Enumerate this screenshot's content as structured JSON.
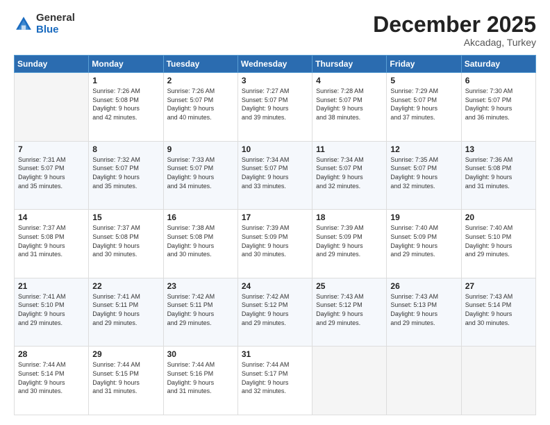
{
  "header": {
    "logo_general": "General",
    "logo_blue": "Blue",
    "month_title": "December 2025",
    "location": "Akcadag, Turkey"
  },
  "weekdays": [
    "Sunday",
    "Monday",
    "Tuesday",
    "Wednesday",
    "Thursday",
    "Friday",
    "Saturday"
  ],
  "weeks": [
    [
      {
        "day": "",
        "info": ""
      },
      {
        "day": "1",
        "info": "Sunrise: 7:26 AM\nSunset: 5:08 PM\nDaylight: 9 hours\nand 42 minutes."
      },
      {
        "day": "2",
        "info": "Sunrise: 7:26 AM\nSunset: 5:07 PM\nDaylight: 9 hours\nand 40 minutes."
      },
      {
        "day": "3",
        "info": "Sunrise: 7:27 AM\nSunset: 5:07 PM\nDaylight: 9 hours\nand 39 minutes."
      },
      {
        "day": "4",
        "info": "Sunrise: 7:28 AM\nSunset: 5:07 PM\nDaylight: 9 hours\nand 38 minutes."
      },
      {
        "day": "5",
        "info": "Sunrise: 7:29 AM\nSunset: 5:07 PM\nDaylight: 9 hours\nand 37 minutes."
      },
      {
        "day": "6",
        "info": "Sunrise: 7:30 AM\nSunset: 5:07 PM\nDaylight: 9 hours\nand 36 minutes."
      }
    ],
    [
      {
        "day": "7",
        "info": "Sunrise: 7:31 AM\nSunset: 5:07 PM\nDaylight: 9 hours\nand 35 minutes."
      },
      {
        "day": "8",
        "info": "Sunrise: 7:32 AM\nSunset: 5:07 PM\nDaylight: 9 hours\nand 35 minutes."
      },
      {
        "day": "9",
        "info": "Sunrise: 7:33 AM\nSunset: 5:07 PM\nDaylight: 9 hours\nand 34 minutes."
      },
      {
        "day": "10",
        "info": "Sunrise: 7:34 AM\nSunset: 5:07 PM\nDaylight: 9 hours\nand 33 minutes."
      },
      {
        "day": "11",
        "info": "Sunrise: 7:34 AM\nSunset: 5:07 PM\nDaylight: 9 hours\nand 32 minutes."
      },
      {
        "day": "12",
        "info": "Sunrise: 7:35 AM\nSunset: 5:07 PM\nDaylight: 9 hours\nand 32 minutes."
      },
      {
        "day": "13",
        "info": "Sunrise: 7:36 AM\nSunset: 5:08 PM\nDaylight: 9 hours\nand 31 minutes."
      }
    ],
    [
      {
        "day": "14",
        "info": "Sunrise: 7:37 AM\nSunset: 5:08 PM\nDaylight: 9 hours\nand 31 minutes."
      },
      {
        "day": "15",
        "info": "Sunrise: 7:37 AM\nSunset: 5:08 PM\nDaylight: 9 hours\nand 30 minutes."
      },
      {
        "day": "16",
        "info": "Sunrise: 7:38 AM\nSunset: 5:08 PM\nDaylight: 9 hours\nand 30 minutes."
      },
      {
        "day": "17",
        "info": "Sunrise: 7:39 AM\nSunset: 5:09 PM\nDaylight: 9 hours\nand 30 minutes."
      },
      {
        "day": "18",
        "info": "Sunrise: 7:39 AM\nSunset: 5:09 PM\nDaylight: 9 hours\nand 29 minutes."
      },
      {
        "day": "19",
        "info": "Sunrise: 7:40 AM\nSunset: 5:09 PM\nDaylight: 9 hours\nand 29 minutes."
      },
      {
        "day": "20",
        "info": "Sunrise: 7:40 AM\nSunset: 5:10 PM\nDaylight: 9 hours\nand 29 minutes."
      }
    ],
    [
      {
        "day": "21",
        "info": "Sunrise: 7:41 AM\nSunset: 5:10 PM\nDaylight: 9 hours\nand 29 minutes."
      },
      {
        "day": "22",
        "info": "Sunrise: 7:41 AM\nSunset: 5:11 PM\nDaylight: 9 hours\nand 29 minutes."
      },
      {
        "day": "23",
        "info": "Sunrise: 7:42 AM\nSunset: 5:11 PM\nDaylight: 9 hours\nand 29 minutes."
      },
      {
        "day": "24",
        "info": "Sunrise: 7:42 AM\nSunset: 5:12 PM\nDaylight: 9 hours\nand 29 minutes."
      },
      {
        "day": "25",
        "info": "Sunrise: 7:43 AM\nSunset: 5:12 PM\nDaylight: 9 hours\nand 29 minutes."
      },
      {
        "day": "26",
        "info": "Sunrise: 7:43 AM\nSunset: 5:13 PM\nDaylight: 9 hours\nand 29 minutes."
      },
      {
        "day": "27",
        "info": "Sunrise: 7:43 AM\nSunset: 5:14 PM\nDaylight: 9 hours\nand 30 minutes."
      }
    ],
    [
      {
        "day": "28",
        "info": "Sunrise: 7:44 AM\nSunset: 5:14 PM\nDaylight: 9 hours\nand 30 minutes."
      },
      {
        "day": "29",
        "info": "Sunrise: 7:44 AM\nSunset: 5:15 PM\nDaylight: 9 hours\nand 31 minutes."
      },
      {
        "day": "30",
        "info": "Sunrise: 7:44 AM\nSunset: 5:16 PM\nDaylight: 9 hours\nand 31 minutes."
      },
      {
        "day": "31",
        "info": "Sunrise: 7:44 AM\nSunset: 5:17 PM\nDaylight: 9 hours\nand 32 minutes."
      },
      {
        "day": "",
        "info": ""
      },
      {
        "day": "",
        "info": ""
      },
      {
        "day": "",
        "info": ""
      }
    ]
  ]
}
